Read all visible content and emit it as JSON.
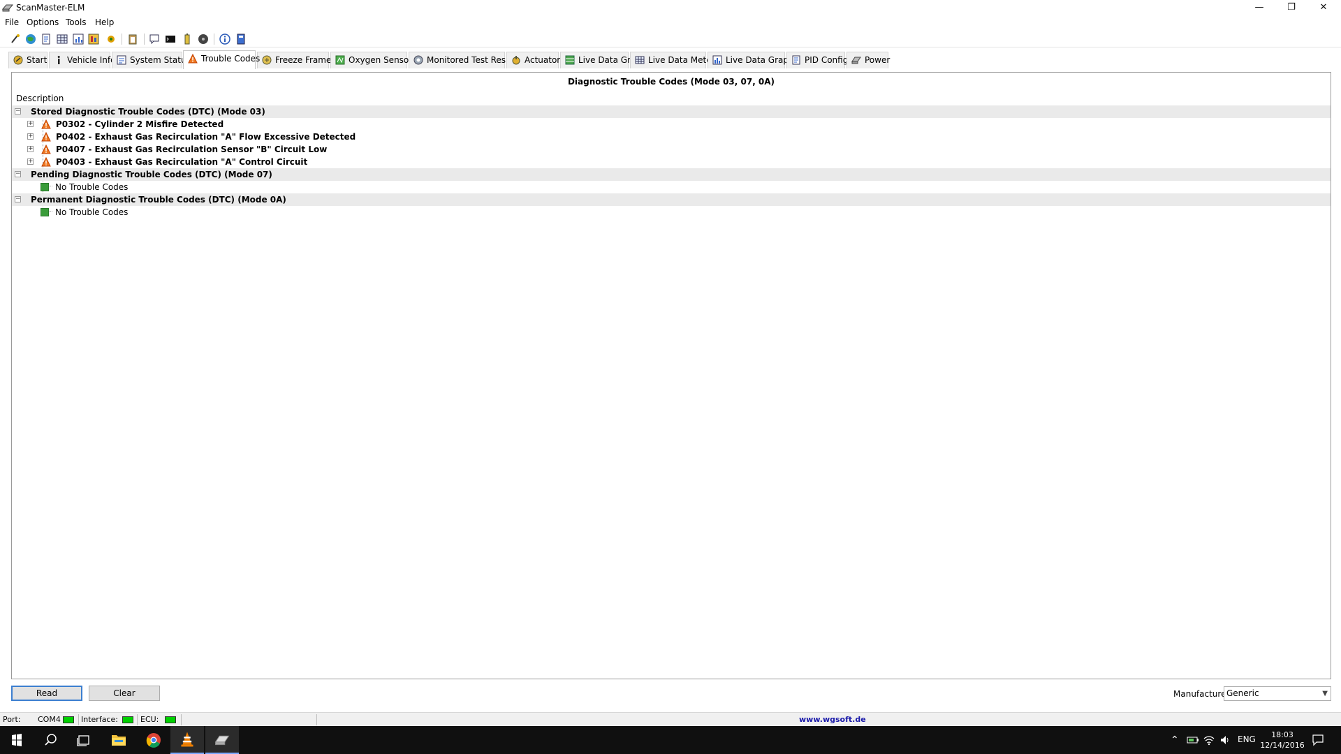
{
  "window": {
    "title": "ScanMaster-ELM",
    "minimize_glyph": "—",
    "restore_glyph": "❐",
    "close_glyph": "✕"
  },
  "menu": [
    "File",
    "Options",
    "Tools",
    "Help"
  ],
  "toolbar": {
    "icons": [
      "connect-icon",
      "globe-icon",
      "document-icon",
      "grid-icon",
      "chart-icon",
      "report-icon",
      "settings-icon",
      "clipboard-icon",
      "chat-icon",
      "terminal-icon",
      "battery-icon",
      "disc-icon",
      "info-icon",
      "book-icon"
    ]
  },
  "tabs": [
    {
      "label": "Start",
      "icon": "start-icon"
    },
    {
      "label": "Vehicle Info",
      "icon": "info-icon"
    },
    {
      "label": "System Status",
      "icon": "status-icon"
    },
    {
      "label": "Trouble Codes",
      "icon": "warning-icon",
      "active": true
    },
    {
      "label": "Freeze Frames",
      "icon": "freeze-icon"
    },
    {
      "label": "Oxygen Sensors",
      "icon": "oxygen-icon"
    },
    {
      "label": "Monitored Test Results",
      "icon": "gear-icon"
    },
    {
      "label": "Actuator",
      "icon": "actuator-icon"
    },
    {
      "label": "Live Data Grid",
      "icon": "grid-icon"
    },
    {
      "label": "Live Data Meter",
      "icon": "meter-icon"
    },
    {
      "label": "Live Data Graph",
      "icon": "graph-icon"
    },
    {
      "label": "PID Config",
      "icon": "config-icon"
    },
    {
      "label": "Power",
      "icon": "power-icon"
    }
  ],
  "panel": {
    "title": "Diagnostic Trouble Codes (Mode 03, 07, 0A)",
    "column_header": "Description",
    "stored": {
      "label": "Stored Diagnostic Trouble Codes (DTC) (Mode 03)",
      "codes": [
        "P0302 - Cylinder 2 Misfire Detected",
        "P0402 - Exhaust Gas Recirculation \"A\" Flow Excessive Detected",
        "P0407 - Exhaust Gas Recirculation Sensor \"B\" Circuit Low",
        "P0403 - Exhaust Gas Recirculation \"A\" Control Circuit"
      ]
    },
    "pending": {
      "label": "Pending Diagnostic Trouble Codes (DTC) (Mode 07)",
      "empty_text": "No Trouble Codes"
    },
    "permanent": {
      "label": "Permanent Diagnostic Trouble Codes (DTC) (Mode 0A)",
      "empty_text": "No Trouble Codes"
    },
    "collapse_glyph": "−",
    "expand_glyph": "+"
  },
  "buttons": {
    "read": "Read",
    "clear": "Clear"
  },
  "manufacturer": {
    "label": "Manufacturer",
    "value": "Generic"
  },
  "statusbar": {
    "port_label": "Port:",
    "port_value": "COM4",
    "interface_label": "Interface:",
    "ecu_label": "ECU:",
    "link": "www.wgsoft.de",
    "led_color": "#00d000"
  },
  "taskbar": {
    "lang": "ENG",
    "time": "18:03",
    "date": "12/14/2016"
  }
}
